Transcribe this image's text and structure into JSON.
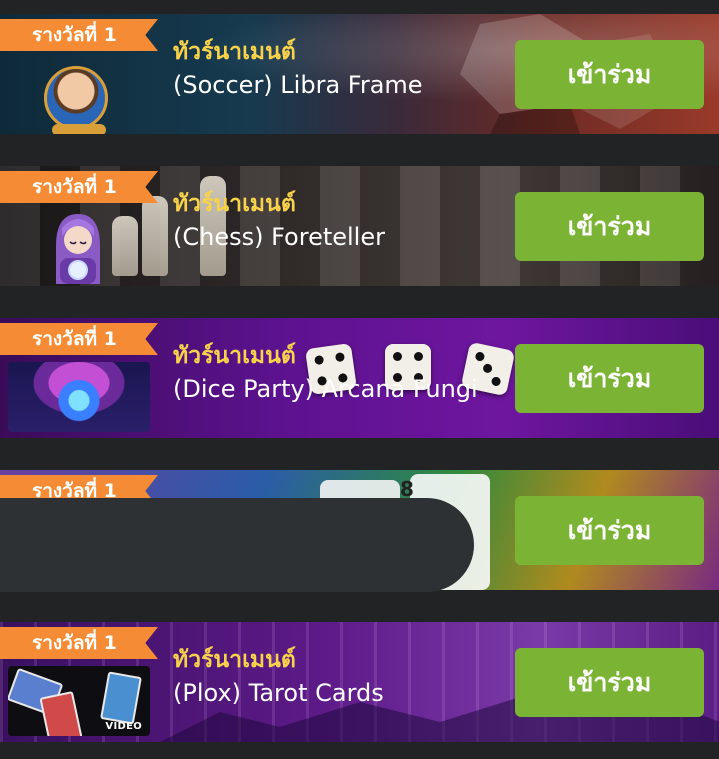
{
  "colors": {
    "background": "#222325",
    "ribbon": "#f58b34",
    "title": "#f7d24a",
    "button": "#7bb434",
    "mask": "#2e3133"
  },
  "tournaments": [
    {
      "badge": "รางวัลที่ 1",
      "title": "ทัวร์นาเมนต์",
      "game": "(Soccer) Libra Frame",
      "button": "เข้าร่วม",
      "thumbnail_icon": "profile-avatar-icon"
    },
    {
      "badge": "รางวัลที่ 1",
      "title": "ทัวร์นาเมนต์",
      "game": "(Chess) Foreteller",
      "button": "เข้าร่วม",
      "thumbnail_icon": "fortune-teller-icon"
    },
    {
      "badge": "รางวัลที่ 1",
      "title": "ทัวร์นาเมนต์",
      "game": "(Dice Party) Arcana Fungi",
      "button": "เข้าร่วม",
      "thumbnail_icon": "arcana-fungi-image"
    },
    {
      "badge": "รางวัลที่ 1",
      "title": "",
      "game": "",
      "button": "เข้าร่วม",
      "thumbnail_icon": ""
    },
    {
      "badge": "รางวัลที่ 1",
      "title": "ทัวร์นาเมนต์",
      "game": "(Plox) Tarot Cards",
      "button": "เข้าร่วม",
      "thumbnail_icon": "tarot-video-thumbnail",
      "video_tag": "VIDEO"
    }
  ]
}
